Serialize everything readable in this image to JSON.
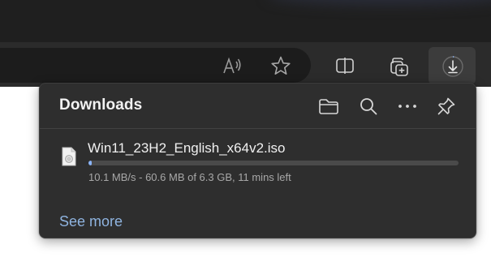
{
  "browser": {
    "toolbar": {
      "icons": [
        "read-aloud-icon",
        "favorite-star-icon",
        "split-screen-icon",
        "collections-icon",
        "downloads-icon"
      ]
    }
  },
  "downloads_panel": {
    "title": "Downloads",
    "actions": [
      "open-folder-icon",
      "search-icon",
      "more-options-icon",
      "pin-icon"
    ],
    "items": [
      {
        "file_name": "Win11_23H2_English_x64v2.iso",
        "status": "10.1 MB/s - 60.6 MB of 6.3 GB, 11 mins left",
        "progress_fraction": 0.0096
      }
    ],
    "see_more_label": "See more"
  },
  "colors": {
    "panel_bg": "#2e2e2e",
    "link": "#8fb4e0",
    "toolbar_bg": "#2b2b2b"
  }
}
